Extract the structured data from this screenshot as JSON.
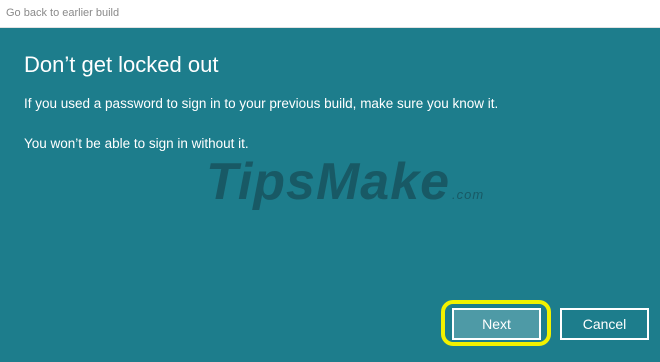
{
  "window": {
    "title": "Go back to earlier build"
  },
  "content": {
    "heading": "Don’t get locked out",
    "paragraph_1": "If you used a password to sign in to your previous build, make sure you know it.",
    "paragraph_2": "You won’t be able to sign in without it."
  },
  "watermark": {
    "text": "TipsMake",
    "suffix": ".com"
  },
  "buttons": {
    "next_label": "Next",
    "cancel_label": "Cancel"
  },
  "colors": {
    "background": "#1d7d8c",
    "highlight": "#f2f200",
    "next_button": "#4e9aa6"
  }
}
